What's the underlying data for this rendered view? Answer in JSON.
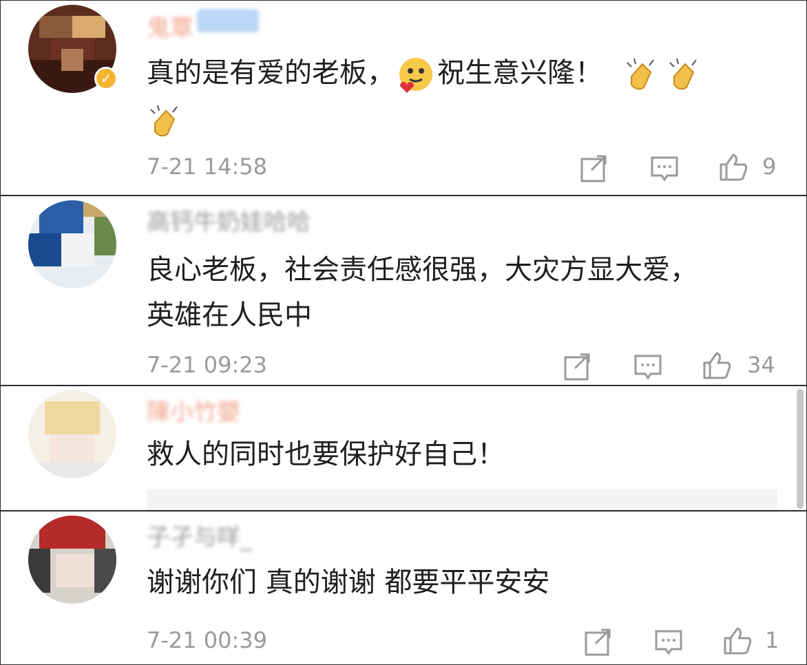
{
  "comments": [
    {
      "username": "鬼覃",
      "text_before": "真的是有爱的老板，",
      "emoji_after_text": "smiling-love-emoji",
      "text_after": "祝生意兴隆！",
      "extra_emojis": [
        "clapping-hands-emoji",
        "clapping-hands-emoji",
        "clapping-hands-emoji"
      ],
      "timestamp": "7-21 14:58",
      "likes": "9",
      "verified": true
    },
    {
      "username": "高钙牛奶娃哈哈",
      "text_line1": "良心老板，社会责任感很强，大灾方显大爱，",
      "text_line2": "英雄在人民中",
      "timestamp": "7-21 09:23",
      "likes": "34"
    },
    {
      "username": "陳小竹嬰",
      "text": "救人的同时也要保护好自己！"
    },
    {
      "username": "子孑与咩_",
      "text": "谢谢你们 真的谢谢 都要平平安安",
      "timestamp": "7-21 00:39",
      "likes": "1"
    }
  ],
  "colors": {
    "text": "#1f1f1f",
    "meta": "#9a9a9a",
    "icon": "#9a9a9a",
    "badge": "#f5b530",
    "fans_badge": "#8fb6f0"
  },
  "icons": {
    "repost": "repost-icon",
    "comment": "comment-icon",
    "like": "thumbs-up-icon"
  }
}
